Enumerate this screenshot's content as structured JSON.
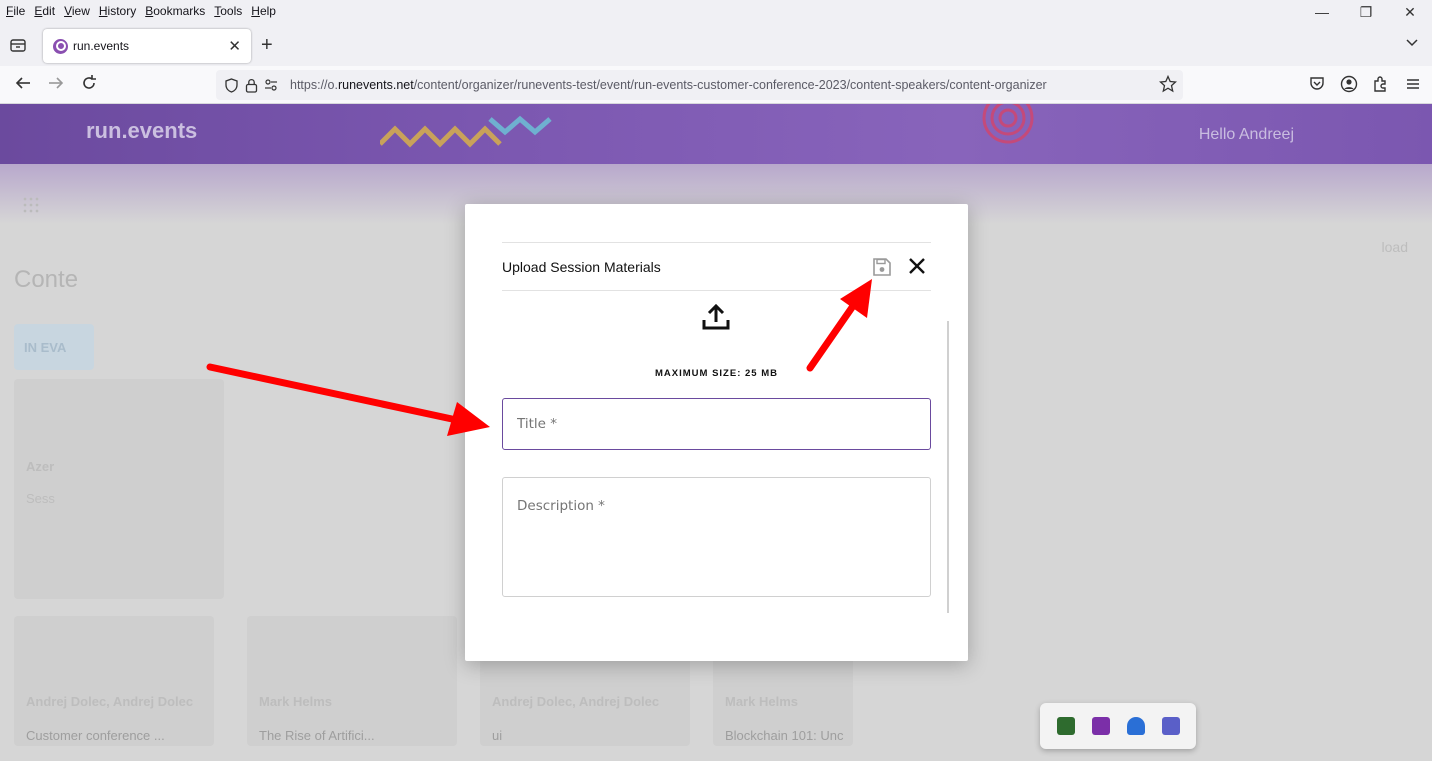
{
  "menu": [
    "File",
    "Edit",
    "View",
    "History",
    "Bookmarks",
    "Tools",
    "Help"
  ],
  "window_controls": {
    "minimize": "—",
    "restore": "❐",
    "close": "✕"
  },
  "tab": {
    "title": "run.events",
    "close": "✕",
    "new_tab": "+"
  },
  "address": {
    "prefix": "https://o.",
    "domain": "runevents.net",
    "path": "/content/organizer/runevents-test/event/run-events-customer-conference-2023/content-speakers/content-organizer"
  },
  "page_bg": {
    "brand": "run.events",
    "greeting": "Hello Andreej",
    "heading": "Conte",
    "filter_chip": "IN EVA",
    "right_link": "load",
    "cards": [
      {
        "name": "Azer",
        "line": "Sess"
      },
      {
        "name": "Andrej Dolec, Andrej Dolec",
        "line": "Customer conference ..."
      },
      {
        "name": "Mark Helms",
        "line": "The Rise of Artifici..."
      },
      {
        "name": "Andrej Dolec, Andrej Dolec",
        "line": "ui"
      },
      {
        "name": "Mark Helms",
        "line": "Blockchain 101: Unc"
      }
    ]
  },
  "modal": {
    "title": "Upload Session Materials",
    "max_size": "MAXIMUM SIZE: 25 MB",
    "title_placeholder": "Title *",
    "description_placeholder": "Description *"
  },
  "colors": {
    "accent": "#6a4a9e",
    "arrow": "#ff0000",
    "banner": "#7b57b0"
  },
  "icons": [
    "save-icon",
    "close-icon",
    "upload-icon",
    "shield-icon",
    "lock-icon",
    "star-icon"
  ]
}
